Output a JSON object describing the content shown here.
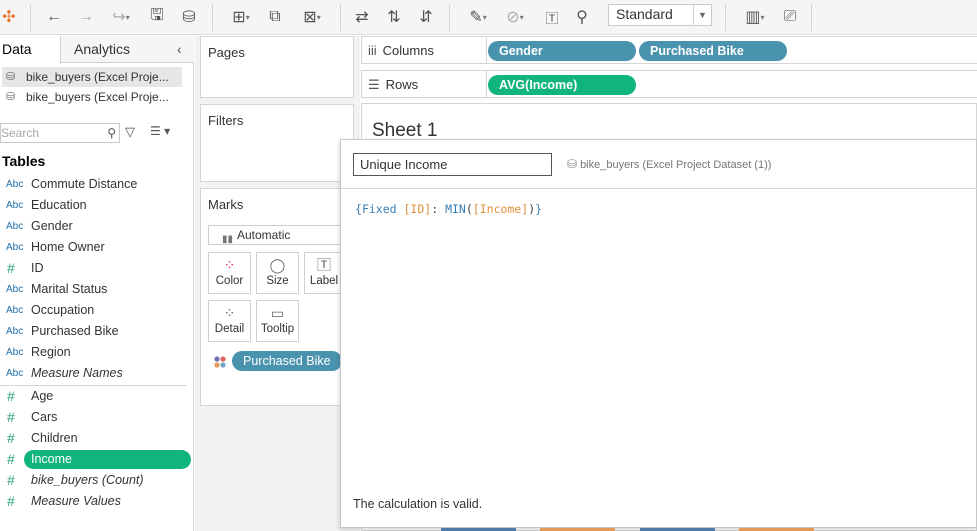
{
  "toolbar": {
    "icons": [
      "tableau-logo-icon",
      "undo-icon",
      "redo-icon",
      "replay-icon",
      "save-icon",
      "new-datasource-icon",
      "new-worksheet-icon",
      "duplicate-icon",
      "clear-sheet-icon",
      "swap-icon",
      "sort-ascending-icon",
      "sort-descending-icon",
      "highlight-icon",
      "group-icon",
      "label-icon",
      "fix-axes-icon",
      "show-me-icon",
      "presentation-icon"
    ],
    "fit_select": "Standard"
  },
  "left_pane": {
    "tab_data": "Data",
    "tab_analytics": "Analytics",
    "datasources": [
      {
        "label": "bike_buyers (Excel Proje..."
      },
      {
        "label": "bike_buyers (Excel Proje..."
      }
    ],
    "search_placeholder": "Search",
    "tables_heading": "Tables",
    "dimensions": [
      {
        "type": "Abc",
        "name": "Commute Distance"
      },
      {
        "type": "Abc",
        "name": "Education"
      },
      {
        "type": "Abc",
        "name": "Gender"
      },
      {
        "type": "Abc",
        "name": "Home Owner"
      },
      {
        "type": "#",
        "name": "ID"
      },
      {
        "type": "Abc",
        "name": "Marital Status"
      },
      {
        "type": "Abc",
        "name": "Occupation"
      },
      {
        "type": "Abc",
        "name": "Purchased Bike"
      },
      {
        "type": "Abc",
        "name": "Region"
      },
      {
        "type": "Abc",
        "name": "Measure Names"
      }
    ],
    "measures": [
      {
        "type": "#",
        "name": "Age"
      },
      {
        "type": "#",
        "name": "Cars"
      },
      {
        "type": "#",
        "name": "Children"
      },
      {
        "type": "#",
        "name": "Income"
      },
      {
        "type": "#",
        "name": "bike_buyers (Count)"
      },
      {
        "type": "#",
        "name": "Measure Values"
      }
    ]
  },
  "cards": {
    "pages": "Pages",
    "filters": "Filters",
    "marks": "Marks",
    "mark_type": "Automatic",
    "buttons": [
      "Color",
      "Size",
      "Label",
      "Detail",
      "Tooltip"
    ],
    "mark_pill": "Purchased Bike"
  },
  "shelves": {
    "columns_label": "Columns",
    "rows_label": "Rows",
    "columns": [
      "Gender",
      "Purchased Bike"
    ],
    "rows": [
      "AVG(Income)"
    ]
  },
  "sheet": {
    "title": "Sheet 1"
  },
  "calc_editor": {
    "name": "Unique Income",
    "datasource": "bike_buyers (Excel Project Dataset (1))",
    "formula": {
      "open": "{",
      "keyword": "Fixed",
      "field1": "[ID]",
      "colon": ":",
      "func": "MIN",
      "paren_open": "(",
      "field2": "[Income]",
      "paren_close": ")",
      "close": "}"
    },
    "status": "The calculation is valid."
  },
  "colors": {
    "dimension_pill": "#4a93ae",
    "measure_pill": "#0fb57a",
    "dim_icon": "#1f6ea6",
    "measure_icon": "#2aa276"
  }
}
